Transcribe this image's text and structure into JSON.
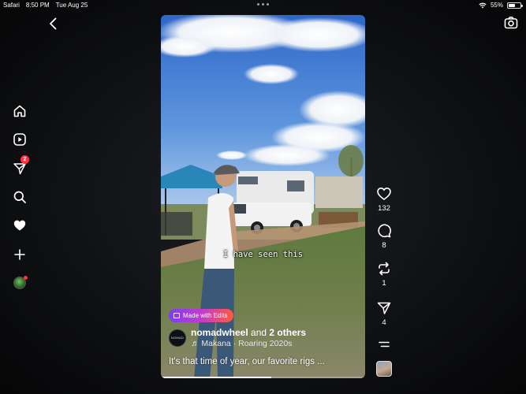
{
  "status_bar": {
    "app": "Safari",
    "time": "8:50 PM",
    "date": "Tue Aug 25",
    "battery": "55%",
    "battery_level": 0.55
  },
  "nav": {
    "items": [
      {
        "name": "home",
        "icon": "home-icon"
      },
      {
        "name": "reels",
        "icon": "reels-icon"
      },
      {
        "name": "messages",
        "icon": "paper-plane-icon",
        "badge": "2"
      },
      {
        "name": "search",
        "icon": "search-icon"
      },
      {
        "name": "notifications",
        "icon": "heart-icon"
      },
      {
        "name": "create",
        "icon": "plus-icon"
      },
      {
        "name": "profile",
        "icon": "avatar"
      }
    ]
  },
  "reel": {
    "subtitle": "I have seen this",
    "edits_badge": "Made with Edits",
    "author": {
      "username": "nomadwheel",
      "others_prefix": "and",
      "others": "2 others",
      "avatar_text": "NOMAD"
    },
    "audio": {
      "note_icon": "♬",
      "track": "Makana · Roaring 2020s"
    },
    "caption": "It's that time of year, our favorite rigs ...",
    "progress": 0.54
  },
  "actions": {
    "likes": "132",
    "comments": "8",
    "reposts": "1",
    "shares": "4"
  },
  "colors": {
    "badge_red": "#ff3040",
    "edits_gradient_start": "#7b3ff2",
    "edits_gradient_end": "#ff5a3c"
  }
}
